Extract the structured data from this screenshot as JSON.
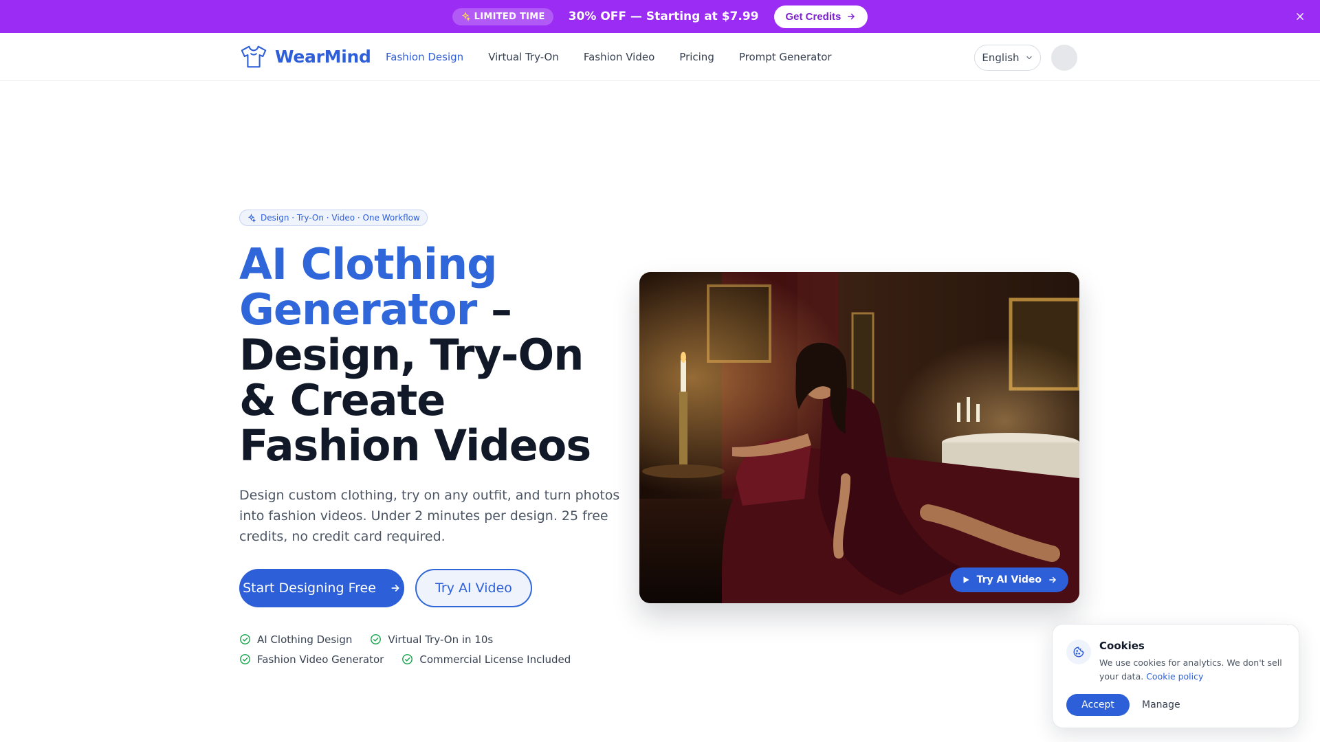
{
  "promo": {
    "badge_icon": "sparkles-icon",
    "badge": "LIMITED TIME",
    "text": "30% OFF — Starting at $7.99",
    "cta": "Get Credits",
    "close_icon": "close-icon",
    "background": "#9b2cf3"
  },
  "nav": {
    "brand": "WearMind",
    "links": [
      "Fashion Design",
      "Virtual Try-On",
      "Fashion Video",
      "Pricing",
      "Prompt Generator"
    ],
    "active_link": "Fashion Design",
    "language": "English"
  },
  "hero": {
    "tagline": "Design · Try-On · Video · One Workflow",
    "title_accent": "AI Clothing Generator",
    "title_rest": " – Design, Try-On & Create Fashion Videos",
    "subtitle": "Design custom clothing, try on any outfit, and turn photos into fashion videos. Under 2 minutes per design. 25 free credits, no credit card required.",
    "primary_cta": "Start Designing Free",
    "secondary_cta": "Try AI Video",
    "features": [
      "AI Clothing Design",
      "Virtual Try-On in 10s",
      "Fashion Video Generator",
      "Commercial License Included"
    ],
    "image_chip": "Try AI Video"
  },
  "cookie": {
    "title": "Cookies",
    "text": "We use cookies for analytics. We don't sell your data.",
    "link": "Cookie policy",
    "accept": "Accept",
    "manage": "Manage"
  },
  "colors": {
    "accent": "#2c5fd8",
    "success": "#16a34a"
  }
}
